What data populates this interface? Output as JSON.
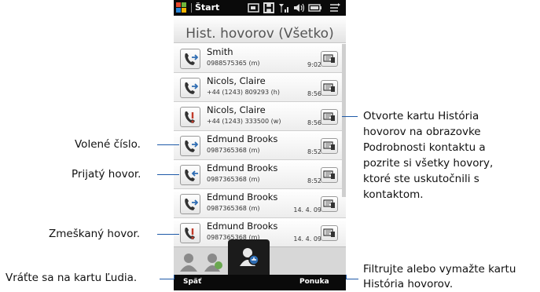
{
  "statusbar": {
    "start_label": "Štart",
    "icons": [
      "windows-logo-icon",
      "contacts-status-icon",
      "h-network-icon",
      "signal-icon",
      "volume-icon",
      "battery-icon",
      "menu-icon"
    ]
  },
  "header": {
    "title": "Hist. hovorov (Všetko)"
  },
  "calls": [
    {
      "name": "Smith",
      "number": "0988575365 (m)",
      "time": "9:02",
      "type": "outgoing"
    },
    {
      "name": "Nicols, Claire",
      "number": "+44 (1243) 809293 (h)",
      "time": "8:56",
      "type": "outgoing"
    },
    {
      "name": "Nicols, Claire",
      "number": "+44 (1243) 333500 (w)",
      "time": "8:56",
      "type": "missed"
    },
    {
      "name": "Edmund Brooks",
      "number": "0987365368 (m)",
      "time": "8:52",
      "type": "outgoing"
    },
    {
      "name": "Edmund Brooks",
      "number": "0987365368 (m)",
      "time": "8:52",
      "type": "received"
    },
    {
      "name": "Edmund Brooks",
      "number": "0987365368 (m)",
      "time": "14. 4. 09",
      "type": "outgoing"
    },
    {
      "name": "Edmund Brooks",
      "number": "0987365368 (m)",
      "time": "14. 4. 09",
      "type": "missed"
    }
  ],
  "tabs": [
    "people-tab-icon",
    "contact-details-tab-icon",
    "call-history-tab-icon"
  ],
  "softkeys": {
    "left": "Späť",
    "right": "Ponuka"
  },
  "callouts": {
    "dialed": "Volené číslo.",
    "received": "Prijatý hovor.",
    "missed": "Zmeškaný hovor.",
    "back": "Vráťte sa na kartu Ľudia.",
    "history_lines": [
      "Otvorte kartu História",
      "hovorov na obrazovke",
      "Podrobnosti kontaktu a",
      "pozrite si všetky hovory,",
      "ktoré ste uskutočnili s",
      "kontaktom."
    ],
    "filter_lines": [
      "Filtrujte alebo vymažte kartu",
      "História hovorov."
    ]
  },
  "colors": {
    "callout_line": "#1e5aa8",
    "outgoing": "#2f6db3",
    "received": "#2f6db3",
    "missed": "#c23b2a"
  }
}
